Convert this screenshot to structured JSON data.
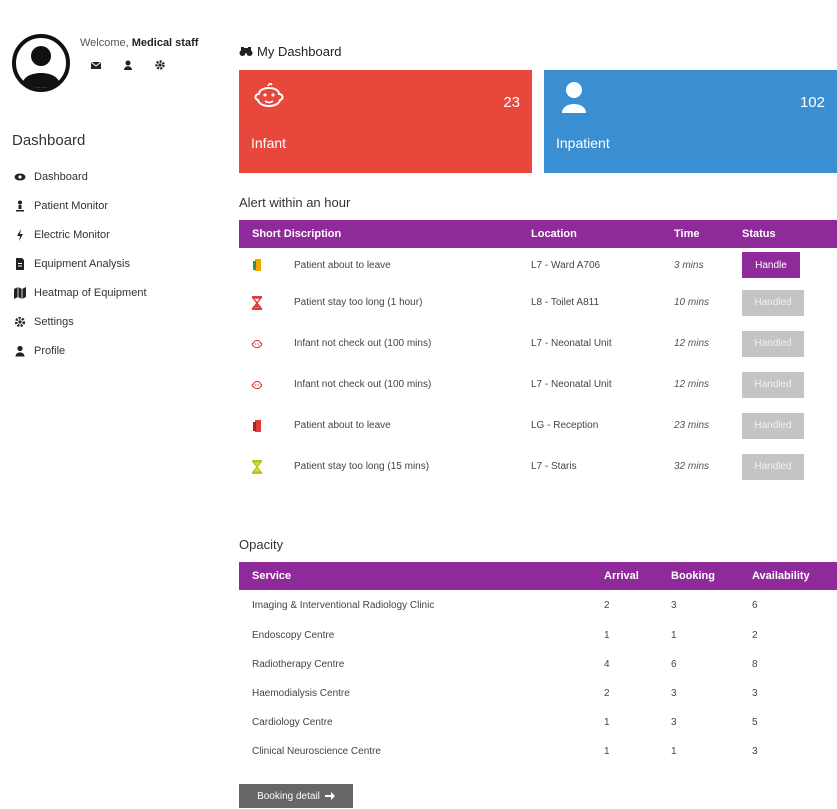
{
  "user": {
    "welcome": "Welcome,",
    "name": "Medical staff"
  },
  "sidebar": {
    "title": "Dashboard",
    "items": [
      {
        "label": "Dashboard",
        "icon": "eye-icon"
      },
      {
        "label": "Patient Monitor",
        "icon": "patient-icon"
      },
      {
        "label": "Electric Monitor",
        "icon": "bolt-icon"
      },
      {
        "label": "Equipment Analysis",
        "icon": "file-icon"
      },
      {
        "label": "Heatmap of Equipment",
        "icon": "map-icon"
      },
      {
        "label": "Settings",
        "icon": "gear-icon"
      },
      {
        "label": "Profile",
        "icon": "user-icon"
      }
    ]
  },
  "header": {
    "title": "My Dashboard"
  },
  "cards": {
    "infant": {
      "label": "Infant",
      "count": "23",
      "color": "#e8473c"
    },
    "inpatient": {
      "label": "Inpatient",
      "count": "102",
      "color": "#3a8fd2"
    }
  },
  "alerts": {
    "title": "Alert within an hour",
    "headers": {
      "desc": "Short Discription",
      "location": "Location",
      "time": "Time",
      "status": "Status"
    },
    "rows": [
      {
        "desc": "Patient about to leave",
        "location": "L7 - Ward A706",
        "time": "3 mins",
        "status": "Handle"
      },
      {
        "desc": "Patient stay too long (1 hour)",
        "location": "L8 - Toilet A811",
        "time": "10 mins",
        "status": "Handled"
      },
      {
        "desc": "Infant not check out (100 mins)",
        "location": "L7 - Neonatal Unit",
        "time": "12 mins",
        "status": "Handled"
      },
      {
        "desc": "Infant not check out (100 mins)",
        "location": "L7 - Neonatal Unit",
        "time": "12 mins",
        "status": "Handled"
      },
      {
        "desc": "Patient about to leave",
        "location": "LG - Reception",
        "time": "23 mins",
        "status": "Handled"
      },
      {
        "desc": "Patient stay too long (15 mins)",
        "location": "L7 - Staris",
        "time": "32 mins",
        "status": "Handled"
      }
    ]
  },
  "opacity": {
    "title": "Opacity",
    "headers": {
      "service": "Service",
      "arrival": "Arrival",
      "booking": "Booking",
      "availability": "Availability"
    },
    "rows": [
      {
        "service": "Imaging & Interventional Radiology Clinic",
        "arrival": "2",
        "booking": "3",
        "availability": "6"
      },
      {
        "service": "Endoscopy Centre",
        "arrival": "1",
        "booking": "1",
        "availability": "2"
      },
      {
        "service": "Radiotherapy Centre",
        "arrival": "4",
        "booking": "6",
        "availability": "8"
      },
      {
        "service": "Haemodialysis Centre",
        "arrival": "2",
        "booking": "3",
        "availability": "3"
      },
      {
        "service": "Cardiology Centre",
        "arrival": "1",
        "booking": "3",
        "availability": "5"
      },
      {
        "service": "Clinical Neuroscience Centre",
        "arrival": "1",
        "booking": "1",
        "availability": "3"
      }
    ]
  },
  "booking_button": {
    "label": "Booking detail"
  },
  "colors": {
    "purple": "#8e2a99",
    "handled": "#c4c4c4"
  }
}
